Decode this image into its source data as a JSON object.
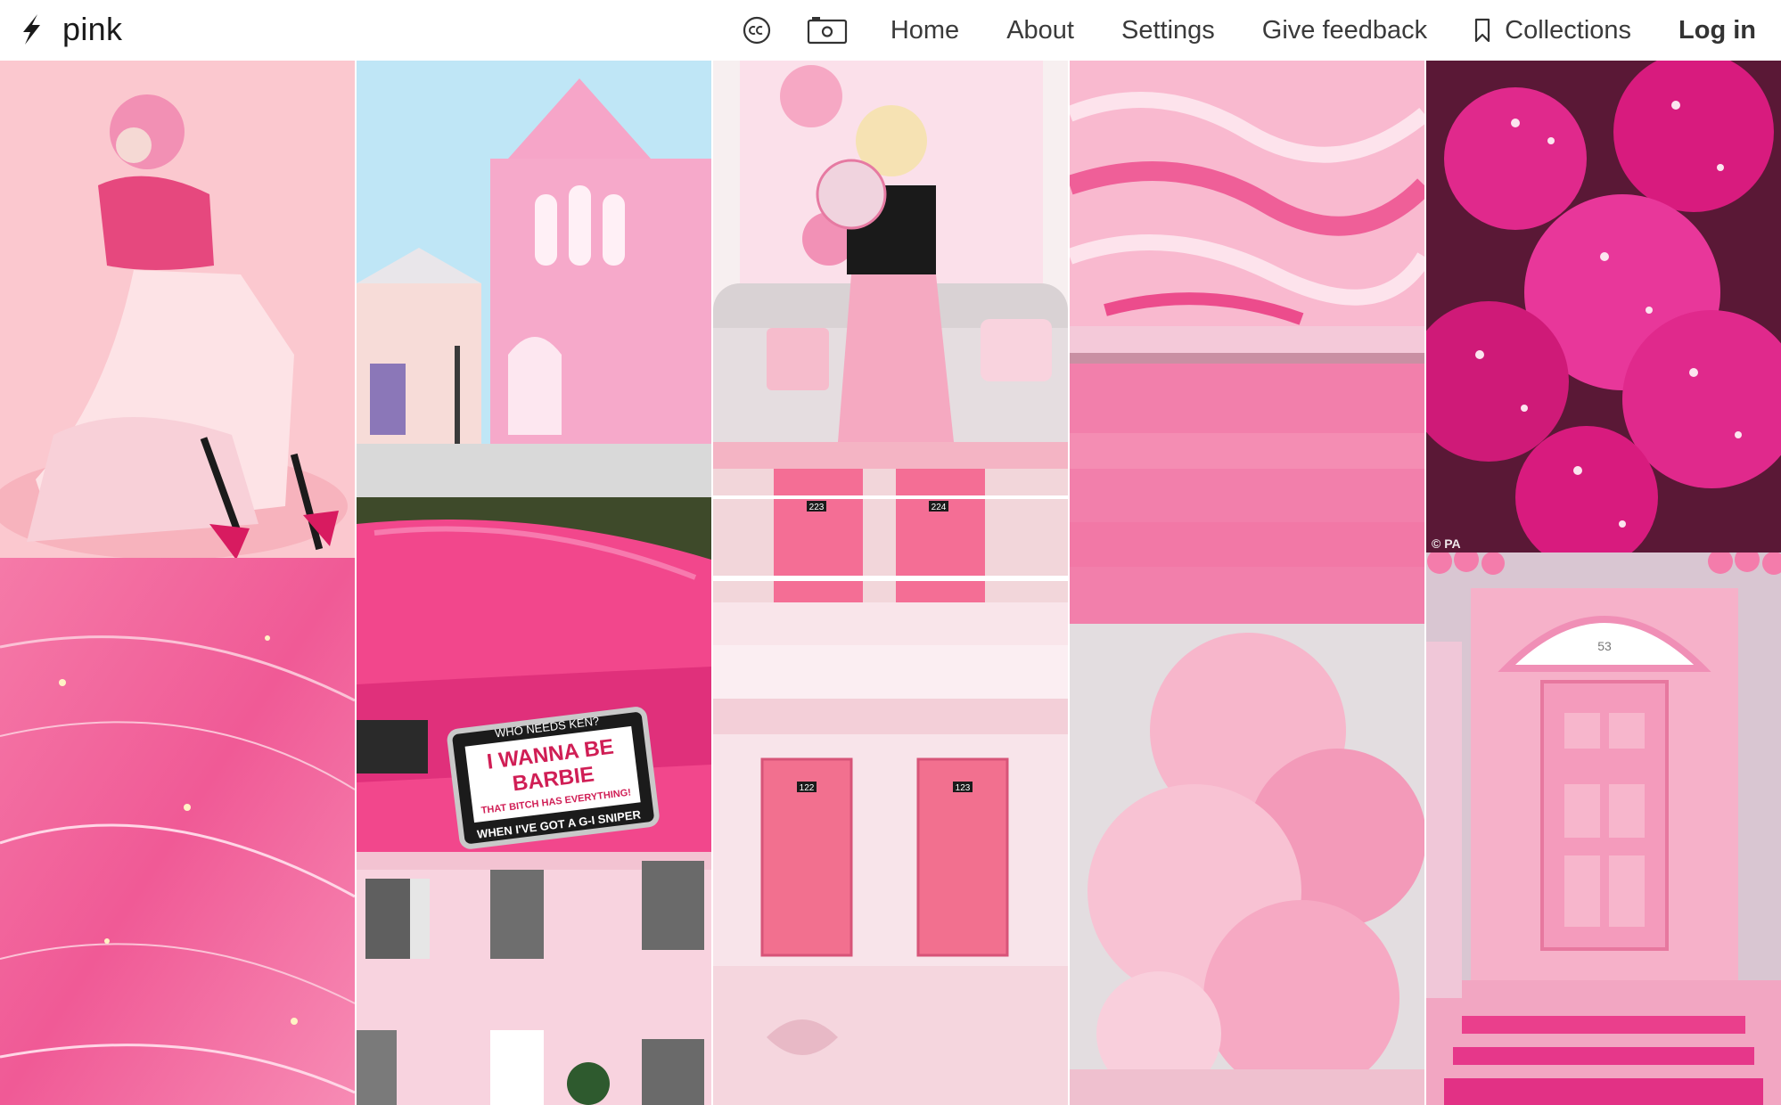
{
  "app": {
    "title": "pink",
    "logo_icon": "lightning-bolt-icon"
  },
  "nav": {
    "cc_icon": "creative-commons-icon",
    "camera_icon": "camera-icon",
    "home": "Home",
    "about": "About",
    "settings": "Settings",
    "feedback": "Give feedback",
    "collections_icon": "bookmark-icon",
    "collections": "Collections",
    "login": "Log in"
  },
  "tiles": {
    "jellyfish_credit": "© PA",
    "motel_upper_doors": [
      "223",
      "224"
    ],
    "motel_lower_doors": [
      "122",
      "123"
    ],
    "door_number": "53",
    "plate_top": "WHO NEEDS KEN?",
    "plate_main_1": "I WANNA BE",
    "plate_main_2": "BARBIE",
    "plate_sub": "THAT BITCH HAS EVERYTHING!",
    "plate_bottom": "WHEN I'VE GOT A G-I SNIPER"
  },
  "colors": {
    "pink_light": "#f8c9d6",
    "pink_mid": "#f07aa5",
    "pink_hot": "#e6398a",
    "magenta": "#d81b7a"
  }
}
